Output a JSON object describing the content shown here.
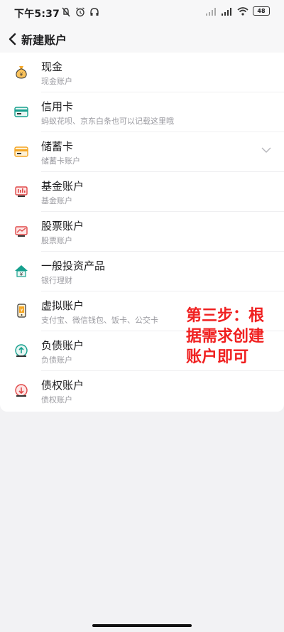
{
  "status_bar": {
    "time": "下午5:37",
    "battery": "48",
    "icons_left": [
      "mute-icon",
      "alarm-icon",
      "headset-icon"
    ],
    "icons_right": [
      "signal-icon",
      "signal-hd-icon",
      "wifi-icon",
      "battery-icon"
    ]
  },
  "nav": {
    "title": "新建账户",
    "back_icon": "chevron-left-icon"
  },
  "items": [
    {
      "title": "现金",
      "subtitle": "现金账户",
      "icon": "money-bag-icon"
    },
    {
      "title": "信用卡",
      "subtitle": "蚂蚁花呗、京东白条也可以记载这里哦",
      "icon": "credit-card-icon"
    },
    {
      "title": "储蓄卡",
      "subtitle": "储蓄卡账户",
      "icon": "debit-card-icon",
      "expand_icon": "chevron-down-icon"
    },
    {
      "title": "基金账户",
      "subtitle": "基金账户",
      "icon": "fund-icon"
    },
    {
      "title": "股票账户",
      "subtitle": "股票账户",
      "icon": "stock-chart-icon"
    },
    {
      "title": "一般投资产品",
      "subtitle": "银行理财",
      "icon": "investment-house-icon"
    },
    {
      "title": "虚拟账户",
      "subtitle": "支付宝、微信钱包、饭卡、公交卡",
      "icon": "phone-wallet-icon"
    },
    {
      "title": "负债账户",
      "subtitle": "负债账户",
      "icon": "liability-icon"
    },
    {
      "title": "债权账户",
      "subtitle": "债权账户",
      "icon": "claim-icon"
    }
  ],
  "annotation": "第三步：根据需求创建账户即可",
  "colors": {
    "accent_orange": "#f5a623",
    "accent_teal": "#16a08e",
    "accent_red": "#e04848",
    "annotation_red": "#f02020"
  }
}
